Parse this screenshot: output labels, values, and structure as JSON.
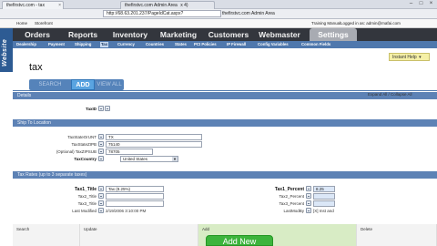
{
  "browser": {
    "tab1": "thefirstvc.com - tax",
    "tab2_prefix": "thefirstvc.com Admin Area",
    "tab2_suffix": "x 4)",
    "address": "http://68.63.201.237/PageIdCat.aspx?",
    "address_right": "thefirstvc.com Admin Area"
  },
  "topstrip": {
    "home": "Home",
    "storefront": "Storefront",
    "training": "Training Manual",
    "logged": "Logged in as: admin@mafai.com"
  },
  "nav": {
    "items": [
      "Orders",
      "Reports",
      "Inventory",
      "Marketing",
      "Customers",
      "Webmaster",
      "Settings"
    ],
    "active": "Settings"
  },
  "subnav": {
    "items": [
      "Dealership",
      "Payment",
      "Shipping",
      "Tax",
      "Currency",
      "Countries",
      "States",
      "PCI Policies",
      "IP Firewall",
      "Config Variables",
      "Common Fields"
    ],
    "active": "Tax"
  },
  "brand": "Website",
  "page": {
    "title": "tax",
    "help": "Instant Help",
    "search": "SEARCH",
    "add": "ADD",
    "view_all": "VIEW ALL",
    "expand_collapse": "Expand All / Collapse All"
  },
  "details": {
    "header": "Details",
    "taxid_label": "TaxID"
  },
  "ship_to": {
    "header": "Ship To Location",
    "fields": [
      {
        "label": "TaxStateOrUNT",
        "value": "TX"
      },
      {
        "label": "TaxStateZIPB",
        "value": "75140"
      },
      {
        "label": "(Optional) TaxZIPSUB",
        "value": "78705"
      },
      {
        "label": "TaxCountry",
        "value": "United States"
      }
    ]
  },
  "tax_rates": {
    "header": "Tax Rates (up to 3 separate taxes)",
    "left": [
      {
        "label": "Tax1_Title",
        "value": "Tax (8.25%)"
      },
      {
        "label": "Tax2_Title",
        "value": ""
      },
      {
        "label": "Tax3_Title",
        "value": ""
      },
      {
        "label": "Last Modified",
        "value": "2/19/2006 3:10:00 PM"
      }
    ],
    "right": [
      {
        "label": "Tax1_Percent",
        "value": "8.25"
      },
      {
        "label": "Tax2_Percent",
        "value": ""
      },
      {
        "label": "Tax3_Percent",
        "value": ""
      },
      {
        "label": "LastModBy",
        "value": "[X] Inst and"
      }
    ]
  },
  "bottom": {
    "cols": [
      "Search",
      "Update",
      "Add",
      "Delete"
    ],
    "add_new": "Add New"
  }
}
